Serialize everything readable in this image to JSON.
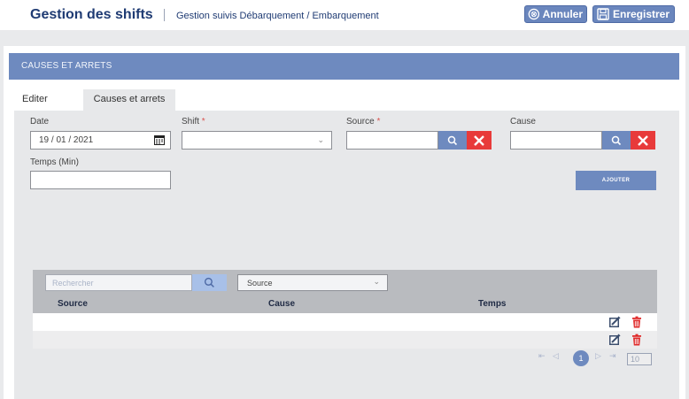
{
  "header": {
    "title": "Gestion des shifts",
    "subtitle": "Gestion suivis Débarquement / Embarquement",
    "buttons": {
      "cancel_label": "Annuler",
      "save_label": "Enregistrer"
    }
  },
  "panel": {
    "title": "CAUSES ET ARRETS"
  },
  "tabs": [
    {
      "label": "Editer"
    },
    {
      "label": "Causes et arrets"
    }
  ],
  "form": {
    "date": {
      "label": "Date",
      "value": "19 / 01 / 2021"
    },
    "shift": {
      "label": "Shift",
      "required_mark": "*",
      "value": ""
    },
    "source": {
      "label": "Source",
      "required_mark": "*",
      "value": ""
    },
    "cause": {
      "label": "Cause",
      "value": ""
    },
    "temps": {
      "label": "Temps (Min)",
      "value": ""
    },
    "add_button": "AJOUTER"
  },
  "table": {
    "search_placeholder": "Rechercher",
    "filter_select": "Source",
    "columns": [
      "Source",
      "Cause",
      "Temps"
    ],
    "rows": [
      {
        "source": "",
        "cause": "",
        "temps": ""
      },
      {
        "source": "",
        "cause": "",
        "temps": ""
      }
    ]
  },
  "pagination": {
    "current_page": "1",
    "page_size": "10"
  },
  "colors": {
    "brand_navy": "#1f3b73",
    "accent_blue": "#6e8abf",
    "danger_red": "#e83a3a"
  },
  "icons": [
    "cancel-icon",
    "save-icon",
    "calendar-icon",
    "chevron-down-icon",
    "search-icon",
    "clear-icon",
    "edit-icon",
    "delete-icon",
    "first-page-icon",
    "prev-page-icon",
    "next-page-icon",
    "last-page-icon"
  ]
}
